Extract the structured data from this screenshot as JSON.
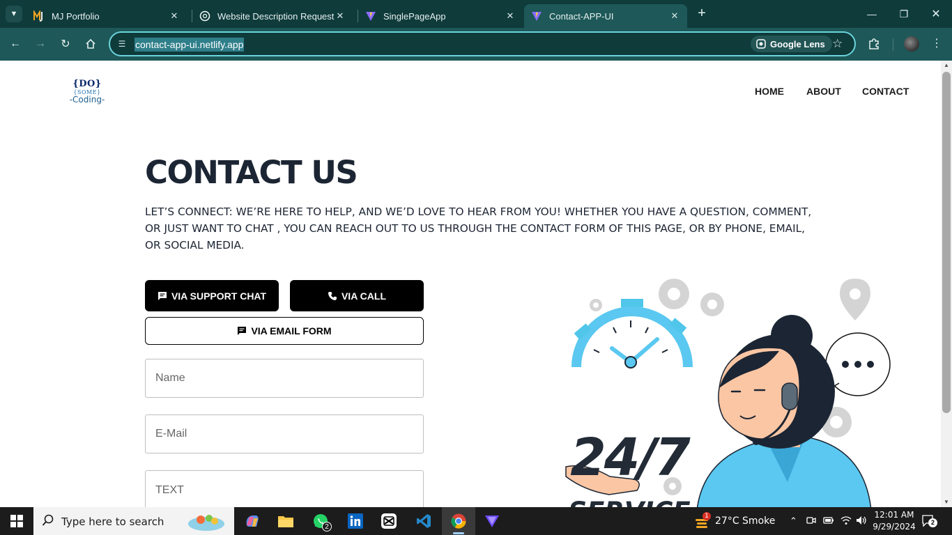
{
  "browser": {
    "tabs": [
      {
        "title": "MJ Portfolio",
        "icon": "mj-logo-icon",
        "active": false
      },
      {
        "title": "Website Description Request",
        "icon": "chatgpt-icon",
        "active": false
      },
      {
        "title": "SinglePageApp",
        "icon": "vite-icon",
        "active": false
      },
      {
        "title": "Contact-APP-UI",
        "icon": "vite-icon",
        "active": true
      }
    ],
    "url": "contact-app-ui.netlify.app",
    "lens_label": "Google Lens",
    "accent_color": "#6ad4dc"
  },
  "site": {
    "logo": {
      "line1": "{DO}",
      "line2": "{SOME}",
      "line3": "-Coding-"
    },
    "nav": [
      "HOME",
      "ABOUT",
      "CONTACT"
    ],
    "title": "CONTACT US",
    "intro": "LET’S CONNECT: WE’RE HERE TO HELP, AND WE’D LOVE TO HEAR FROM YOU! WHETHER YOU HAVE A QUESTION, COMMENT, OR JUST WANT TO CHAT , YOU CAN REACH OUT TO US THROUGH THE CONTACT FORM OF THIS PAGE, OR BY PHONE, EMAIL, OR SOCIAL MEDIA.",
    "buttons": {
      "support_chat": "VIA SUPPORT CHAT",
      "call": "VIA CALL",
      "email_form": "VIA EMAIL FORM"
    },
    "form": {
      "name_placeholder": "Name",
      "email_placeholder": "E-Mail",
      "text_placeholder": "TEXT"
    },
    "illustration": {
      "big": "24/7",
      "sub": "SERVICE"
    }
  },
  "taskbar": {
    "search_placeholder": "Type here to search",
    "whatsapp_badge": "2",
    "weather": "27°C  Smoke",
    "weather_badge": "1",
    "time": "12:01 AM",
    "date": "9/29/2024",
    "notification_count": "2"
  }
}
